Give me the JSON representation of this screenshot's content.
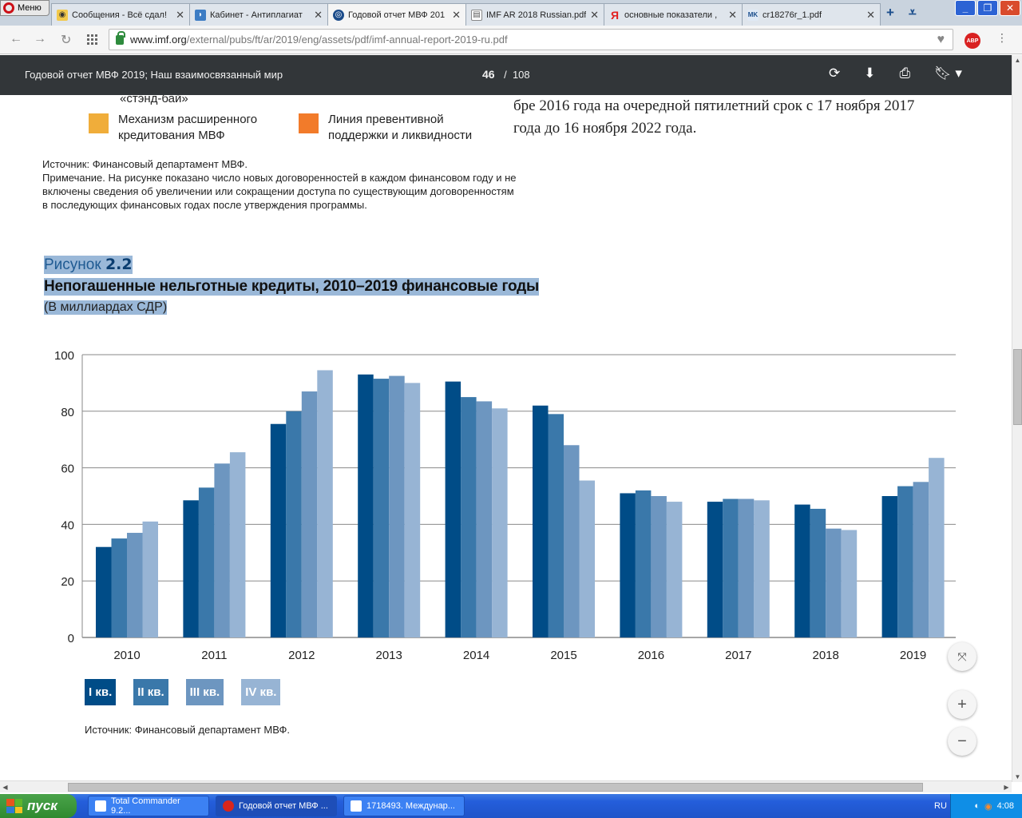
{
  "browser": {
    "menu_label": "Меню",
    "tabs": [
      {
        "label": "Сообщения - Всё сдал!",
        "icon": "owl-icon",
        "active": false
      },
      {
        "label": "Кабинет - Антиплагиат",
        "icon": "shield-icon",
        "active": false
      },
      {
        "label": "Годовой отчет МВФ 201",
        "icon": "imf-icon",
        "active": true
      },
      {
        "label": "IMF AR 2018 Russian.pdf",
        "icon": "doc-icon",
        "active": false
      },
      {
        "label": "основные показатели ,",
        "icon": "yandex-icon",
        "active": false
      },
      {
        "label": "cr18276r_1.pdf",
        "icon": "mk-icon",
        "active": false
      }
    ],
    "url_domain": "www.imf.org",
    "url_path": "/external/pubs/ft/ar/2019/eng/assets/pdf/imf-annual-report-2019-ru.pdf",
    "abp_label": "ABP"
  },
  "pdf": {
    "title": "Годовой отчет МВФ 2019; Наш взаимосвязанный мир",
    "current_page": "46",
    "separator": "/",
    "total_pages": "108"
  },
  "page": {
    "partial_top": "«стэнд-бай»",
    "legend": [
      {
        "text": "Механизм расширенного кредитования МВФ",
        "color": "#f0ad3a"
      },
      {
        "text": "Линия превентивной поддержки и ликвидности",
        "color": "#f27b2a"
      }
    ],
    "note_source": "Источник: Финансовый департамент МВФ.",
    "note_text": "Примечание. На рисунке показано число новых договоренностей в каждом финансовом году и не включены сведения об увеличении или сокращении доступа по существующим договоренностям в последующих финансовых годах после утверждения программы.",
    "right_text": "бре 2016 года на очередной пятилетний срок с 17 ноября 2017 года до 16 ноября 2022 года.",
    "figure_label": "Рисунок ",
    "figure_number": "2.2",
    "figure_title": "Непогашенные нельготные кредиты, 2010–2019 финансовые годы",
    "figure_subtitle": "(В миллиардах СДР)",
    "figure_source": "Источник: Финансовый департамент МВФ."
  },
  "chart_data": {
    "type": "bar",
    "title": "Непогашенные нельготные кредиты, 2010–2019 финансовые годы",
    "subtitle": "(В миллиардах СДР)",
    "categories": [
      "2010",
      "2011",
      "2012",
      "2013",
      "2014",
      "2015",
      "2016",
      "2017",
      "2018",
      "2019"
    ],
    "series": [
      {
        "name": "I кв.",
        "color": "#004c87",
        "values": [
          32,
          48.5,
          75.5,
          93,
          90.5,
          82,
          51,
          48,
          47,
          50
        ]
      },
      {
        "name": "II кв.",
        "color": "#3a78aa",
        "values": [
          35,
          53,
          80,
          91.5,
          85,
          79,
          52,
          49,
          45.5,
          53.5
        ]
      },
      {
        "name": "III кв.",
        "color": "#6d96c0",
        "values": [
          37,
          61.5,
          87,
          92.5,
          83.5,
          68,
          50,
          49,
          38.5,
          55
        ]
      },
      {
        "name": "IV кв.",
        "color": "#97b4d4",
        "values": [
          41,
          65.5,
          94.5,
          90,
          81,
          55.5,
          48,
          48.5,
          38,
          63.5
        ]
      }
    ],
    "yticks": [
      "0",
      "20",
      "40",
      "60",
      "80",
      "100"
    ],
    "ylim": [
      0,
      100
    ],
    "grid": true,
    "legend_position": "bottom-left"
  },
  "taskbar": {
    "start_label": "пуск",
    "tasks": [
      {
        "label": "Total Commander 9.2...",
        "active": false
      },
      {
        "label": "Годовой отчет МВФ ...",
        "active": true
      },
      {
        "label": "1718493. Междунар...",
        "active": false
      }
    ],
    "lang": "RU",
    "clock": "4:08"
  }
}
